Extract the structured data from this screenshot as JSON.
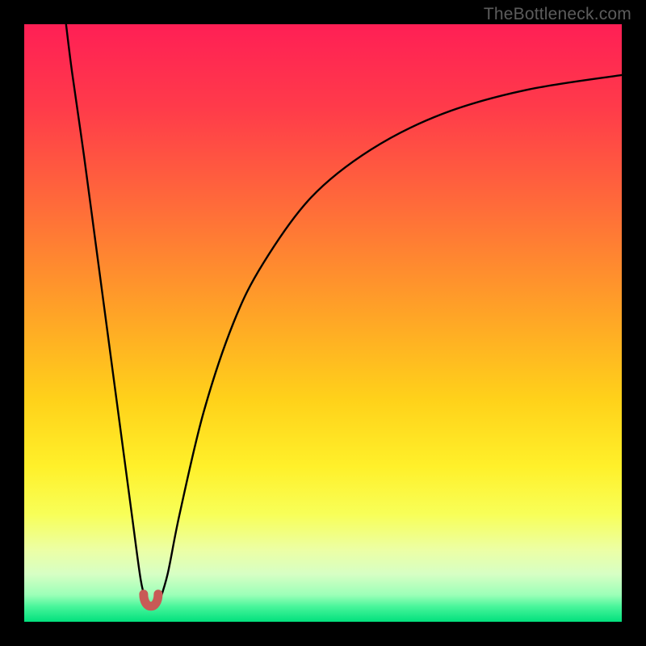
{
  "watermark": "TheBottleneck.com",
  "chart_data": {
    "type": "line",
    "title": "",
    "xlabel": "",
    "ylabel": "",
    "xlim": [
      0,
      100
    ],
    "ylim": [
      0,
      100
    ],
    "grid": false,
    "series": [
      {
        "name": "left-branch",
        "x": [
          7,
          8,
          10,
          12,
          14,
          16,
          18,
          19.5,
          20.5
        ],
        "values": [
          100,
          92,
          78,
          63,
          48,
          33,
          18,
          7,
          3
        ]
      },
      {
        "name": "right-branch",
        "x": [
          22.5,
          24,
          26,
          30,
          35,
          40,
          48,
          58,
          70,
          84,
          100
        ],
        "values": [
          3,
          8,
          18,
          35,
          50,
          60,
          71,
          79,
          85,
          89,
          91.5
        ]
      }
    ],
    "markers": [
      {
        "name": "dip-marker",
        "x": 21.2,
        "y": 3,
        "color": "#c85a56",
        "shape": "u"
      }
    ],
    "background_gradient_stops": [
      {
        "pct": 0,
        "color": "#ff1f55"
      },
      {
        "pct": 14,
        "color": "#ff3b4a"
      },
      {
        "pct": 30,
        "color": "#ff6a3a"
      },
      {
        "pct": 48,
        "color": "#ffa227"
      },
      {
        "pct": 63,
        "color": "#ffd21a"
      },
      {
        "pct": 74,
        "color": "#fff02a"
      },
      {
        "pct": 82,
        "color": "#f8ff58"
      },
      {
        "pct": 88,
        "color": "#ecffa5"
      },
      {
        "pct": 92,
        "color": "#d7ffc4"
      },
      {
        "pct": 95.5,
        "color": "#9cffb8"
      },
      {
        "pct": 97.5,
        "color": "#47f59a"
      },
      {
        "pct": 100,
        "color": "#02e07d"
      }
    ]
  }
}
